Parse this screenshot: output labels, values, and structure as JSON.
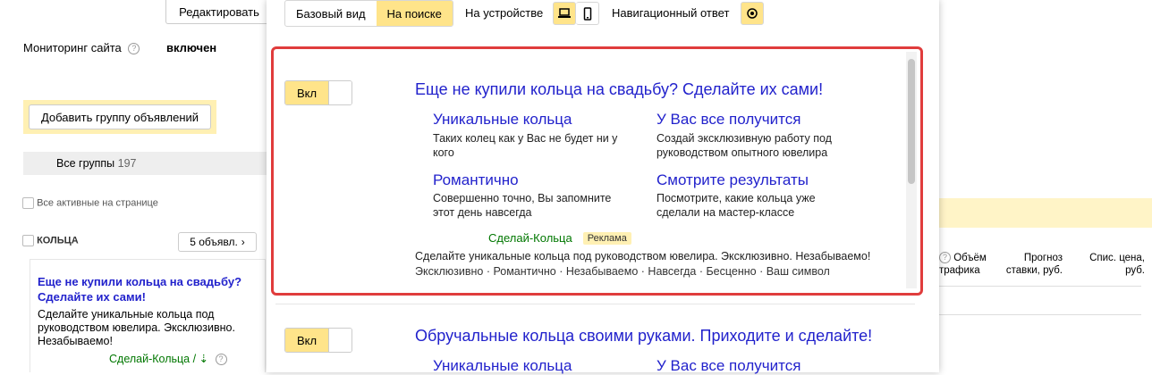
{
  "background": {
    "edit_button": "Редактировать",
    "monitoring_label": "Мониторинг сайта",
    "monitoring_value": "включен",
    "add_group_button": "Добавить группу объявлений",
    "all_groups_label": "Все группы",
    "all_groups_count": "197",
    "all_active_label": "Все активные на странице",
    "group_name": "КОЛЬЦА",
    "ads_count_button": "5 объявл.",
    "ad_preview_title": "Еще не купили кольца на свадьбу? Сделайте их сами!",
    "ad_preview_text": "Сделайте уникальные кольца под руководством ювелира. Эксклюзивно. Незабываемо!",
    "ad_preview_domain": "Сделай-Кольца /",
    "col_traffic": "Объём трафика",
    "col_forecast": "Прогноз ставки, руб.",
    "col_price": "Спис. цена, руб."
  },
  "popup": {
    "view_basic": "Базовый вид",
    "view_search": "На поиске",
    "device_label": "На устройстве",
    "nav_answer_label": "Навигационный ответ",
    "ads": [
      {
        "toggle": "Вкл",
        "title": "Еще не купили кольца на свадьбу? Сделайте их сами!",
        "sitelinks": [
          {
            "title": "Уникальные кольца",
            "desc": "Таких колец как у Вас не будет ни у кого"
          },
          {
            "title": "У Вас все получится",
            "desc": "Создай эксклюзивную работу под руководством опытного ювелира"
          },
          {
            "title": "Романтично",
            "desc": "Совершенно точно, Вы запомните этот день навсегда"
          },
          {
            "title": "Смотрите результаты",
            "desc": "Посмотрите, какие кольца уже сделали на мастер-классе"
          }
        ],
        "domain": "Сделай-Кольца",
        "badge": "Реклама",
        "text": "Сделайте уникальные кольца под руководством ювелира. Эксклюзивно. Незабываемо!",
        "callouts": [
          "Эксклюзивно",
          "Романтично",
          "Незабываемо",
          "Навсегда",
          "Бесценно",
          "Ваш символ"
        ]
      },
      {
        "toggle": "Вкл",
        "title": "Обручальные кольца своими руками. Приходите и сделайте!",
        "sitelinks": [
          {
            "title": "Уникальные кольца"
          },
          {
            "title": "У Вас все получится"
          }
        ]
      }
    ]
  },
  "colors": {
    "accent_yellow": "#ffe48a",
    "link_blue": "#2222cc",
    "domain_green": "#007700",
    "frame_red": "#e03c3c"
  }
}
